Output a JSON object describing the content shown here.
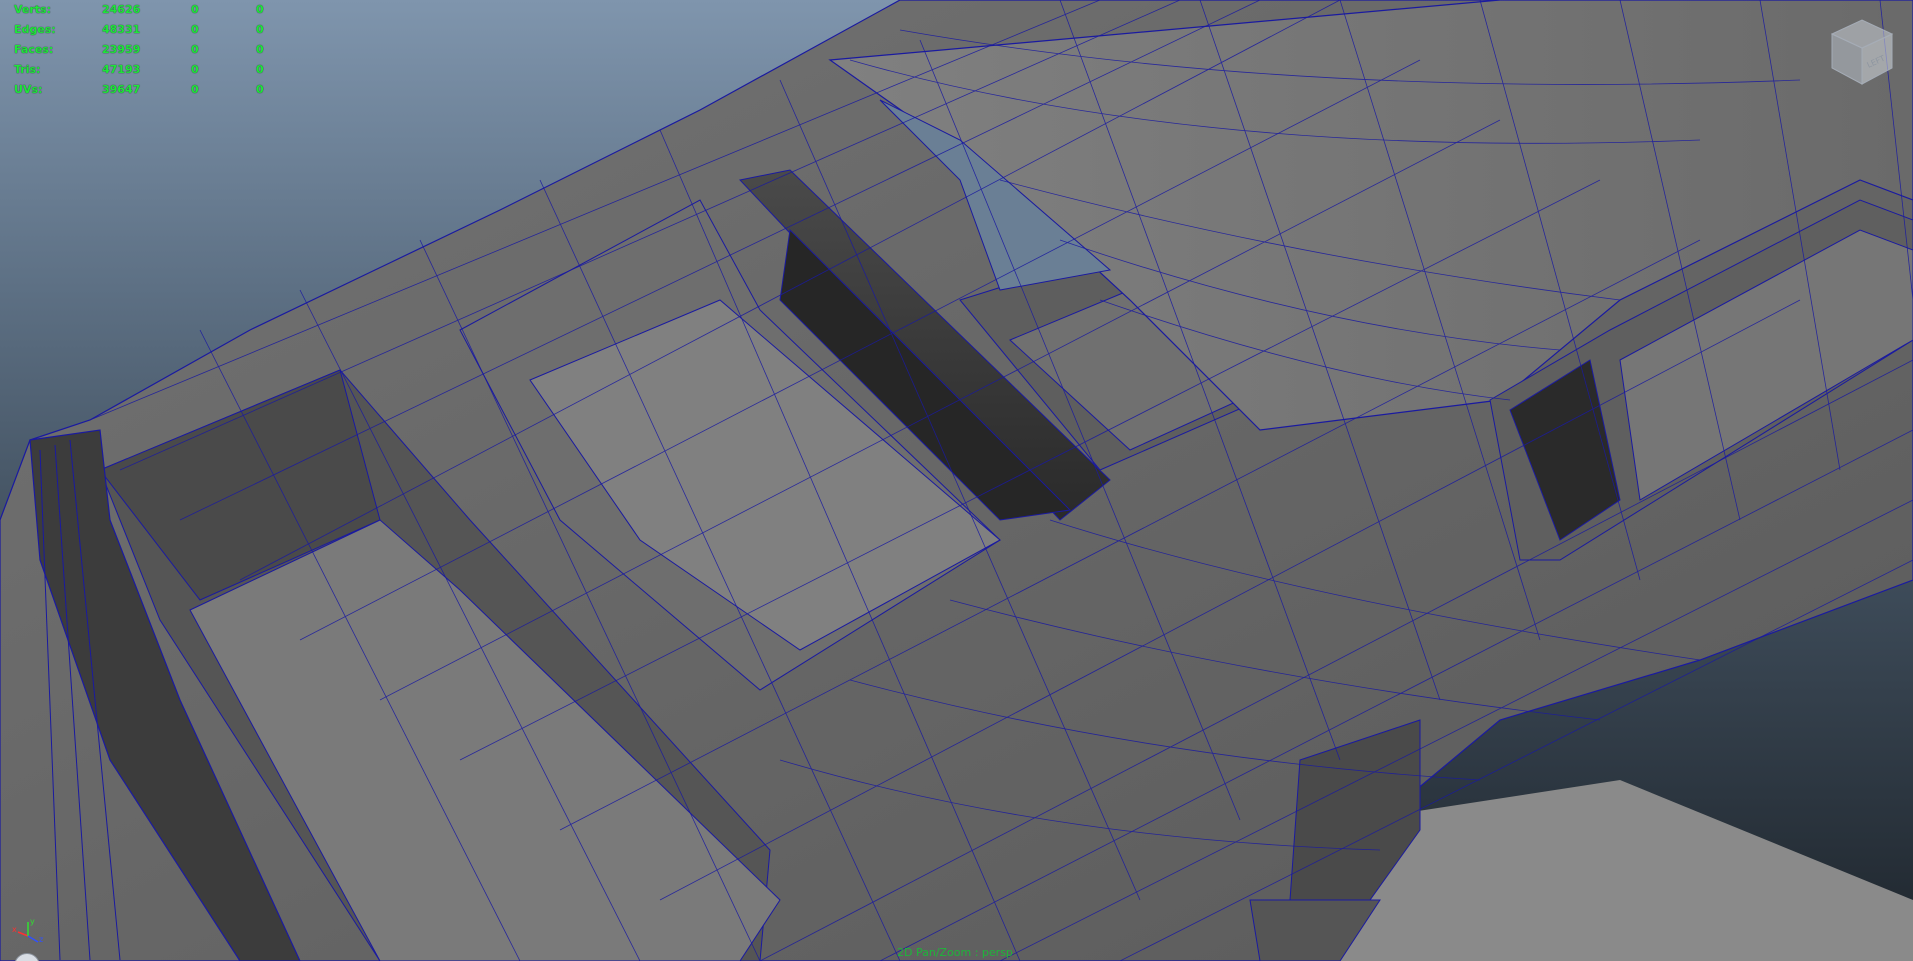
{
  "hud": {
    "rows": [
      {
        "label": "Verts:",
        "values": [
          "24626",
          "0",
          "0"
        ]
      },
      {
        "label": "Edges:",
        "values": [
          "48331",
          "0",
          "0"
        ]
      },
      {
        "label": "Faces:",
        "values": [
          "23959",
          "0",
          "0"
        ]
      },
      {
        "label": "Tris:",
        "values": [
          "47193",
          "0",
          "0"
        ]
      },
      {
        "label": "UVs:",
        "values": [
          "39647",
          "0",
          "0"
        ]
      }
    ]
  },
  "viewport": {
    "camera_label": "2D Pan/Zoom : persp",
    "view_cube_face": "LEFT",
    "axis_labels": {
      "x": "x",
      "y": "y",
      "z": "z"
    }
  },
  "colors": {
    "hud_text": "#1ee53a",
    "wireframe": "#1a1aa0",
    "mesh_gray": "#6c6c6c",
    "background_top": "#7f95ad",
    "background_bottom": "#1e252c"
  },
  "icons": [
    "view-cube-icon",
    "axis-gizmo-icon"
  ]
}
